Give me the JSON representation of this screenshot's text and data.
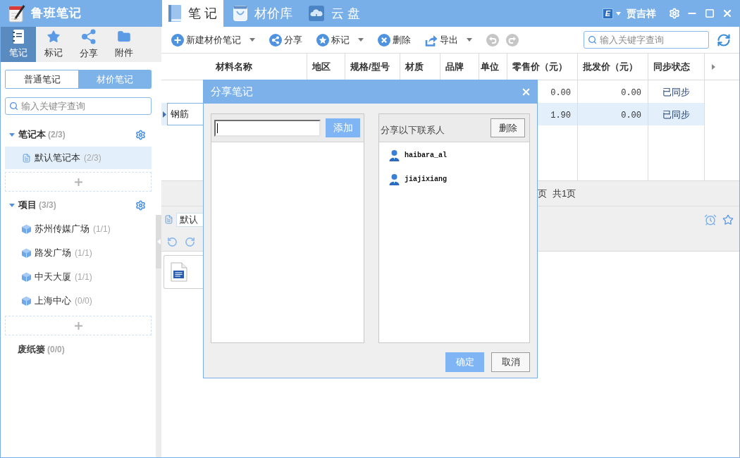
{
  "app": {
    "title": "鲁班笔记"
  },
  "sidebar": {
    "tabs": [
      {
        "label": "笔记",
        "kind": "notes",
        "selected": true
      },
      {
        "label": "标记",
        "kind": "marks",
        "selected": false
      },
      {
        "label": "分享",
        "kind": "share",
        "selected": false
      },
      {
        "label": "附件",
        "kind": "attachments",
        "selected": false
      }
    ],
    "note_types": [
      {
        "label": "普通笔记",
        "selected": false
      },
      {
        "label": "材价笔记",
        "selected": true
      }
    ],
    "search": {
      "placeholder": "输入关键字查询"
    },
    "sections": [
      {
        "title": "笔记本",
        "count": "(2/3)",
        "kind": "notebook",
        "expanded": true,
        "items": [
          {
            "label": "默认笔记本",
            "count": "(2/3)",
            "selected": true
          }
        ]
      },
      {
        "title": "项目",
        "count": "(3/3)",
        "kind": "project",
        "expanded": true,
        "items": [
          {
            "label": "苏州传媒广场",
            "count": "(1/1)",
            "selected": false
          },
          {
            "label": "路发广场",
            "count": "(1/1)",
            "selected": false
          },
          {
            "label": "中天大厦",
            "count": "(1/1)",
            "selected": false
          },
          {
            "label": "上海中心",
            "count": "(0/0)",
            "selected": false
          }
        ]
      }
    ],
    "trash": {
      "label": "废纸篓",
      "count": "(0/0)"
    }
  },
  "header": {
    "tabs": [
      {
        "label": "笔 记",
        "kind": "notes",
        "selected": true
      },
      {
        "label": "材价库",
        "kind": "library",
        "selected": false
      },
      {
        "label": "云 盘",
        "kind": "cloud",
        "selected": false
      }
    ],
    "user": {
      "badge": "E",
      "name": "贾吉祥"
    }
  },
  "toolbar": {
    "buttons": [
      {
        "kind": "new",
        "label": "新建材价笔记",
        "dropdown": true,
        "disabled": false
      },
      {
        "kind": "share",
        "label": "分享",
        "dropdown": false,
        "disabled": false
      },
      {
        "kind": "mark",
        "label": "标记",
        "dropdown": true,
        "disabled": false
      },
      {
        "kind": "delete",
        "label": "删除",
        "dropdown": false,
        "disabled": false
      },
      {
        "kind": "export",
        "label": "导出",
        "dropdown": true,
        "disabled": false
      },
      {
        "kind": "undo",
        "dropdown": false,
        "disabled": true
      },
      {
        "kind": "redo",
        "dropdown": false,
        "disabled": true
      }
    ],
    "search": {
      "placeholder": "输入关键字查询"
    }
  },
  "table": {
    "columns": [
      "材料名称",
      "地区",
      "规格/型号",
      "材质",
      "品牌",
      "单位",
      "零售价（元）",
      "批发价（元）",
      "同步状态"
    ],
    "rows": [
      {
        "selected": false,
        "editing": false,
        "retail_price": "0.00",
        "wholesale_price": "0.00",
        "sync_status": "已同步"
      },
      {
        "selected": true,
        "editing": true,
        "material": "钢筋",
        "retail_price": "1.90",
        "wholesale_price": "0.00",
        "sync_status": "已同步"
      }
    ]
  },
  "pagination": {
    "page_label": "页",
    "total": "共1页"
  },
  "note_pane": {
    "notebook": "默认"
  },
  "dialog": {
    "title": "分享笔记",
    "add_button": "添加",
    "contacts_title": "分享以下联系人",
    "delete_button": "删除",
    "contacts": [
      {
        "name": "haibara_al"
      },
      {
        "name": "jiajixiang"
      }
    ],
    "buttons": [
      {
        "label": "确定",
        "primary": true
      },
      {
        "label": "取消",
        "primary": false
      }
    ]
  }
}
